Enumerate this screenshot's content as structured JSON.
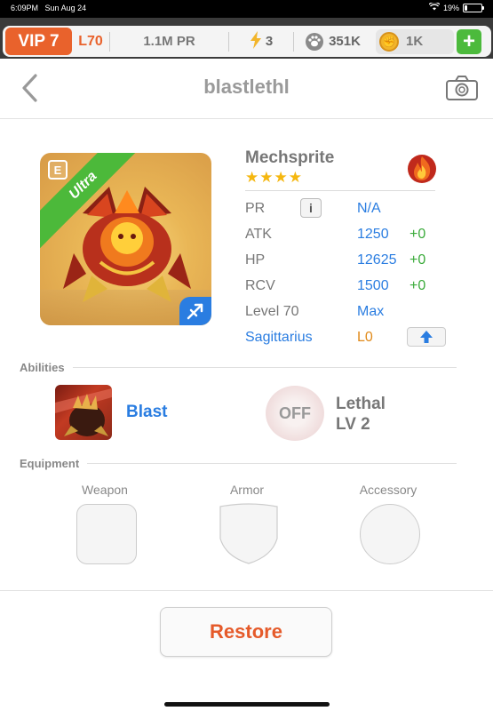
{
  "status_bar": {
    "time": "6:09PM",
    "date": "Sun Aug 24",
    "battery": "19%",
    "battery_level": 0.19
  },
  "resources": {
    "vip": "VIP 7",
    "level": "L70",
    "pr": "1.1M PR",
    "stamina": "3",
    "paws": "351K",
    "coins": "1K",
    "add": "+"
  },
  "header": {
    "title": "blastlethl"
  },
  "monster": {
    "name": "Mechsprite",
    "rarity": "Ultra",
    "card_tag": "E",
    "stars": "★★★★",
    "element": "fire",
    "stats": [
      {
        "label": "PR",
        "value": "N/A",
        "bonus": ""
      },
      {
        "label": "ATK",
        "value": "1250",
        "bonus": "+0"
      },
      {
        "label": "HP",
        "value": "12625",
        "bonus": "+0"
      },
      {
        "label": "RCV",
        "value": "1500",
        "bonus": "+0"
      },
      {
        "label": "Level 70",
        "value": "Max",
        "bonus": ""
      }
    ],
    "zodiac": {
      "label": "Sagittarius",
      "value": "L0"
    }
  },
  "abilities": {
    "title": "Abilities",
    "active": {
      "name": "Blast"
    },
    "passive": {
      "state": "OFF",
      "name": "Lethal",
      "level": "LV 2"
    }
  },
  "equipment": {
    "title": "Equipment",
    "slots": [
      "Weapon",
      "Armor",
      "Accessory"
    ]
  },
  "footer": {
    "restore_label": "Restore"
  },
  "colors": {
    "accent_orange": "#e9622c",
    "accent_blue": "#2a7de1",
    "accent_green": "#4cb93a",
    "star": "#f5b70f"
  }
}
